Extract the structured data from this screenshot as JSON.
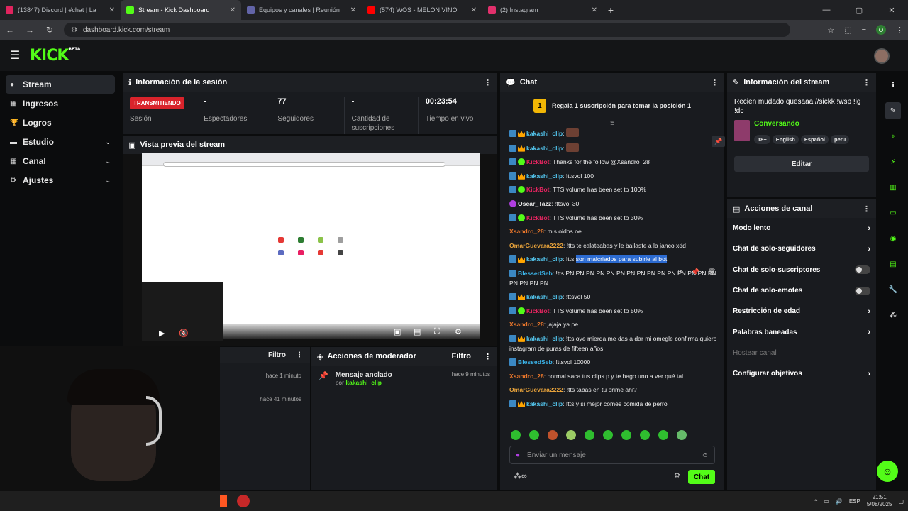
{
  "browser": {
    "tabs": [
      {
        "label": "(13847) Discord | #chat | La",
        "color": "#e0245e"
      },
      {
        "label": "Stream - Kick Dashboard",
        "color": "#53fc18",
        "active": true
      },
      {
        "label": "Equipos y canales | Reunión",
        "color": "#6264a7"
      },
      {
        "label": "(574) WOS - MELON VINO",
        "color": "#ff0000"
      },
      {
        "label": "(2) Instagram",
        "color": "#e1306c"
      }
    ],
    "url": "dashboard.kick.com/stream",
    "profile_initial": "O"
  },
  "brand": {
    "logo": "KICK",
    "beta": "BETA"
  },
  "sidebar": {
    "items": [
      {
        "label": "Stream",
        "icon": "stream-icon"
      },
      {
        "label": "Ingresos",
        "icon": "dollar-icon"
      },
      {
        "label": "Logros",
        "icon": "trophy-icon"
      },
      {
        "label": "Estudio",
        "icon": "studio-icon"
      },
      {
        "label": "Canal",
        "icon": "channel-icon"
      },
      {
        "label": "Ajustes",
        "icon": "gear-icon"
      }
    ]
  },
  "session": {
    "title": "Información de la sesión",
    "live_badge": "TRANSMITIENDO",
    "session_label": "Sesión",
    "stats": [
      {
        "value": "-",
        "label": "Espectadores"
      },
      {
        "value": "77",
        "label": "Seguidores"
      },
      {
        "value": "-",
        "label": "Cantidad de suscripciones"
      },
      {
        "value": "00:23:54",
        "label": "Tiempo en vivo"
      }
    ]
  },
  "preview": {
    "title": "Vista previa del stream"
  },
  "activity": {
    "filter": "Filtro",
    "times": [
      "hace 1 minuto",
      "hace 41 minutos"
    ]
  },
  "mod": {
    "title": "Acciones de moderador",
    "filter": "Filtro",
    "pinned": "Mensaje anclado",
    "by": "por",
    "by_user": "kakashi_clip",
    "time": "hace 9 minutos"
  },
  "chat": {
    "title": "Chat",
    "gift_rank": "1",
    "gift_text": "Regala 1 suscripción para tomar la posición 1",
    "messages": [
      {
        "user": "kakashi_clip",
        "color": "#53c7f0",
        "badges": [
          "mod",
          "crown"
        ],
        "text": "",
        "avatar": true
      },
      {
        "user": "kakashi_clip",
        "color": "#53c7f0",
        "badges": [
          "mod",
          "crown"
        ],
        "text": "",
        "avatar": true
      },
      {
        "user": "KickBot",
        "color": "#e0245e",
        "badges": [
          "mod",
          "ver"
        ],
        "text": ": Thanks for the follow @Xsandro_28"
      },
      {
        "user": "kakashi_clip",
        "color": "#53c7f0",
        "badges": [
          "mod",
          "crown"
        ],
        "text": ": !ttsvol 100"
      },
      {
        "user": "KickBot",
        "color": "#e0245e",
        "badges": [
          "mod",
          "ver"
        ],
        "text": ": TTS volume has been set to 100%"
      },
      {
        "user": "Oscar_Tazz",
        "color": "#e8e8e8",
        "badges": [
          "mic"
        ],
        "text": ": !ttsvol 30"
      },
      {
        "user": "KickBot",
        "color": "#e0245e",
        "badges": [
          "mod",
          "ver"
        ],
        "text": ": TTS volume has been set to 30%"
      },
      {
        "user": "Xsandro_28",
        "color": "#e8762b",
        "badges": [],
        "text": ": mis oidos oe"
      },
      {
        "user": "OmarGuevara2222",
        "color": "#e8a33b",
        "badges": [],
        "text": ": !tts te calateabas y le bailaste a la janco xdd"
      },
      {
        "user": "kakashi_clip",
        "color": "#53c7f0",
        "badges": [
          "mod",
          "crown"
        ],
        "text": ": !tts ",
        "highlight": "son malcriados para subirle al bot"
      },
      {
        "user": "BlessedSeb",
        "color": "#3bb3e8",
        "badges": [
          "mod"
        ],
        "text": ": !tts PN PN PN PN PN PN PN PN PN PN PN PN PN PN PN PN PN PN PN"
      },
      {
        "user": "kakashi_clip",
        "color": "#53c7f0",
        "badges": [
          "mod",
          "crown"
        ],
        "text": ": !ttsvol 50"
      },
      {
        "user": "KickBot",
        "color": "#e0245e",
        "badges": [
          "mod",
          "ver"
        ],
        "text": ": TTS volume has been set to 50%"
      },
      {
        "user": "Xsandro_28",
        "color": "#e8762b",
        "badges": [],
        "text": ": jajaja ya pe"
      },
      {
        "user": "kakashi_clip",
        "color": "#53c7f0",
        "badges": [
          "mod",
          "crown"
        ],
        "text": ": !tts oye mierda me das a dar mi omegle confirma quiero instagram de puras de fifteen años"
      },
      {
        "user": "BlessedSeb",
        "color": "#3bb3e8",
        "badges": [
          "mod"
        ],
        "text": ": !ttsvol 10000"
      },
      {
        "user": "Xsandro_28",
        "color": "#e8762b",
        "badges": [],
        "text": ": normal saca tus clips p y te hago uno a ver qué tal"
      },
      {
        "user": "OmarGuevara2222",
        "color": "#e8a33b",
        "badges": [],
        "text": ": !tts tabas en tu prime ahi?"
      },
      {
        "user": "kakashi_clip",
        "color": "#53c7f0",
        "badges": [
          "mod",
          "crown"
        ],
        "text": ": !tts y si mejor comes comida de perro"
      }
    ],
    "input_placeholder": "Enviar un mensaje",
    "send_label": "Chat"
  },
  "stream_info": {
    "title": "Información del stream",
    "stream_title": "Recien mudado quesaaa //sickk !wsp !ig !dc",
    "category": "Conversando",
    "tags": [
      "18+",
      "English",
      "Español",
      "peru"
    ],
    "edit_label": "Editar"
  },
  "channel_actions": {
    "title": "Acciones de canal",
    "items": [
      {
        "label": "Modo lento",
        "kind": "chevron"
      },
      {
        "label": "Chat de solo-seguidores",
        "kind": "chevron"
      },
      {
        "label": "Chat de solo-suscriptores",
        "kind": "toggle"
      },
      {
        "label": "Chat de solo-emotes",
        "kind": "toggle"
      },
      {
        "label": "Restricción de edad",
        "kind": "chevron"
      },
      {
        "label": "Palabras baneadas",
        "kind": "chevron"
      },
      {
        "label": "Hostear canal",
        "kind": "disabled"
      },
      {
        "label": "Configurar objetivos",
        "kind": "chevron"
      }
    ]
  },
  "taskbar": {
    "lang": "ESP",
    "time": "21:51",
    "date": "5/08/2025"
  },
  "colors": {
    "accent": "#53fc18",
    "live": "#d9232b",
    "panel": "#191b1f"
  }
}
